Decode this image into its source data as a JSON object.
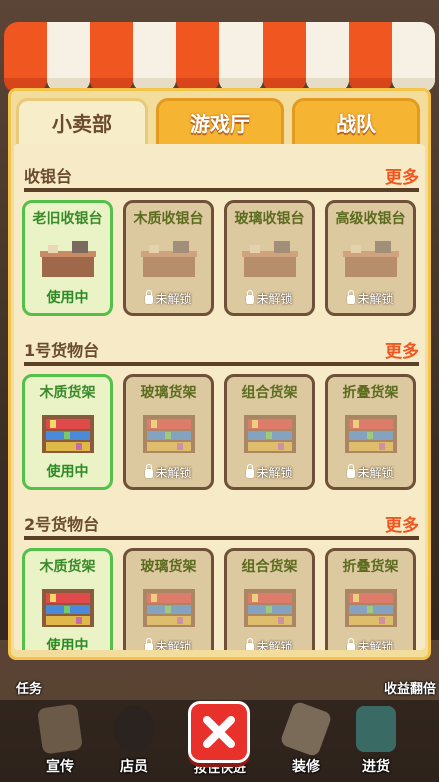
{
  "tabs": [
    {
      "label": "小卖部",
      "active": true
    },
    {
      "label": "游戏厅",
      "active": false
    },
    {
      "label": "战队",
      "active": false
    }
  ],
  "sections": [
    {
      "title": "收银台",
      "more": "更多",
      "items": [
        {
          "name": "老旧收银台",
          "status": "使用中",
          "in_use": true,
          "icon": "old-counter-icon"
        },
        {
          "name": "木质收银台",
          "status": "未解锁",
          "in_use": false,
          "icon": "wood-counter-icon"
        },
        {
          "name": "玻璃收银台",
          "status": "未解锁",
          "in_use": false,
          "icon": "glass-counter-icon"
        },
        {
          "name": "高级收银台",
          "status": "未解锁",
          "in_use": false,
          "icon": "premium-counter-icon"
        }
      ]
    },
    {
      "title": "1号货物台",
      "more": "更多",
      "items": [
        {
          "name": "木质货架",
          "status": "使用中",
          "in_use": true,
          "icon": "wood-shelf-icon"
        },
        {
          "name": "玻璃货架",
          "status": "未解锁",
          "in_use": false,
          "icon": "glass-shelf-icon"
        },
        {
          "name": "组合货架",
          "status": "未解锁",
          "in_use": false,
          "icon": "combo-shelf-icon"
        },
        {
          "name": "折叠货架",
          "status": "未解锁",
          "in_use": false,
          "icon": "folding-shelf-icon"
        }
      ]
    },
    {
      "title": "2号货物台",
      "more": "更多",
      "items": [
        {
          "name": "木质货架",
          "status": "使用中",
          "in_use": true,
          "icon": "wood-shelf-icon"
        },
        {
          "name": "玻璃货架",
          "status": "未解锁",
          "in_use": false,
          "icon": "glass-shelf-icon"
        },
        {
          "name": "组合货架",
          "status": "未解锁",
          "in_use": false,
          "icon": "combo-shelf-icon"
        },
        {
          "name": "折叠货架",
          "status": "未解锁",
          "in_use": false,
          "icon": "folding-shelf-icon"
        }
      ]
    }
  ],
  "background": {
    "left_label": "任务",
    "right_label": "收益翻倍"
  },
  "bottom_nav": [
    {
      "label": "宣传",
      "icon": "megaphone-icon"
    },
    {
      "label": "店员",
      "icon": "staff-icon"
    },
    {
      "label": "按住快进",
      "icon": "fast-forward-icon"
    },
    {
      "label": "装修",
      "icon": "hammer-icon"
    },
    {
      "label": "进货",
      "icon": "restock-icon"
    }
  ],
  "colors": {
    "awning_orange": "#f0561f",
    "panel": "#f3dd9c",
    "more_orange": "#f0561f",
    "in_use_green": "#53c049",
    "close_red": "#e9312c"
  }
}
